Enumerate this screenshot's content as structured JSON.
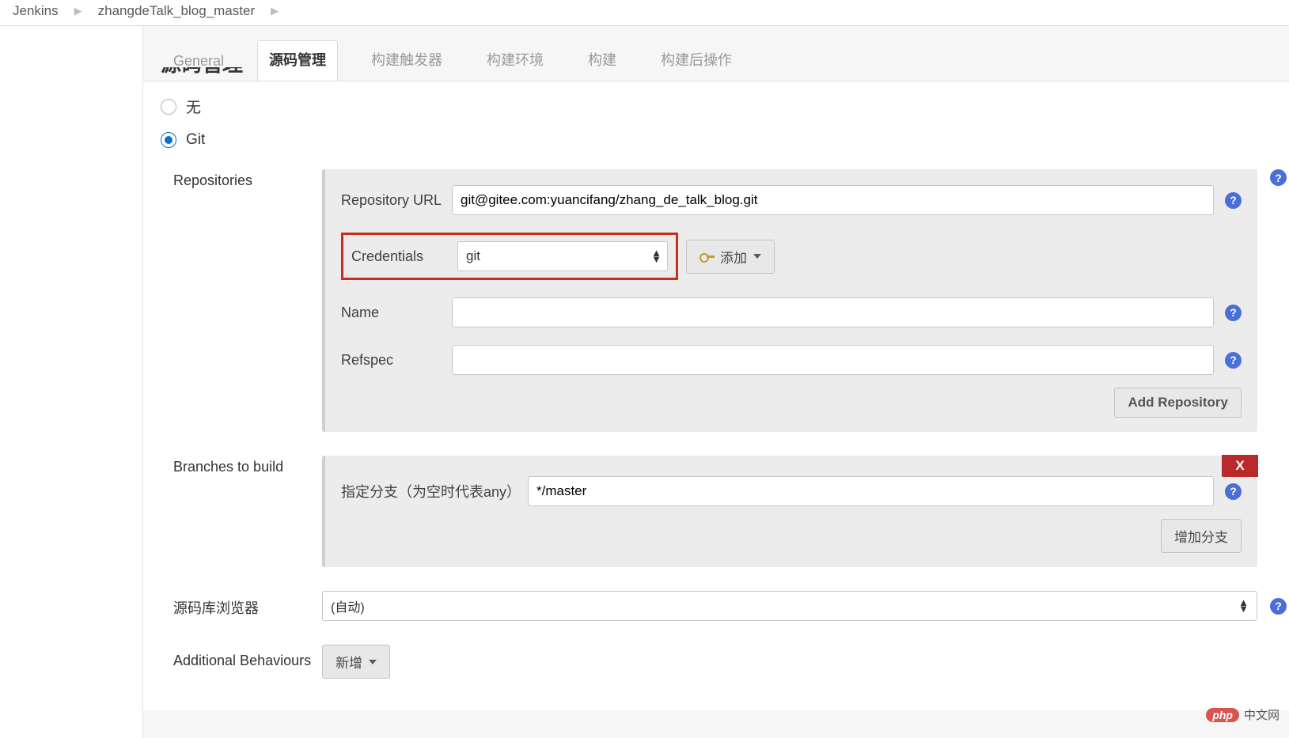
{
  "breadcrumb": {
    "root": "Jenkins",
    "project": "zhangdeTalk_blog_master"
  },
  "tabs": {
    "general": "General",
    "scm": "源码管理",
    "triggers": "构建触发器",
    "env": "构建环境",
    "build": "构建",
    "post": "构建后操作"
  },
  "section_heading_cut": "源码管理",
  "scm": {
    "none_label": "无",
    "git_label": "Git",
    "repositories_label": "Repositories",
    "repo_url_label": "Repository URL",
    "repo_url_value": "git@gitee.com:yuancifang/zhang_de_talk_blog.git",
    "credentials_label": "Credentials",
    "credentials_value": "git",
    "add_credentials_label": "添加",
    "name_label": "Name",
    "name_value": "",
    "refspec_label": "Refspec",
    "refspec_value": "",
    "add_repo_label": "Add Repository",
    "branches_label": "Branches to build",
    "branch_spec_label": "指定分支（为空时代表any）",
    "branch_spec_value": "*/master",
    "add_branch_label": "增加分支",
    "remove_x": "X",
    "browser_label": "源码库浏览器",
    "browser_value": "(自动)",
    "behaviours_label": "Additional Behaviours",
    "behaviours_add": "新增"
  },
  "watermark": {
    "pill": "php",
    "text": "中文网"
  }
}
